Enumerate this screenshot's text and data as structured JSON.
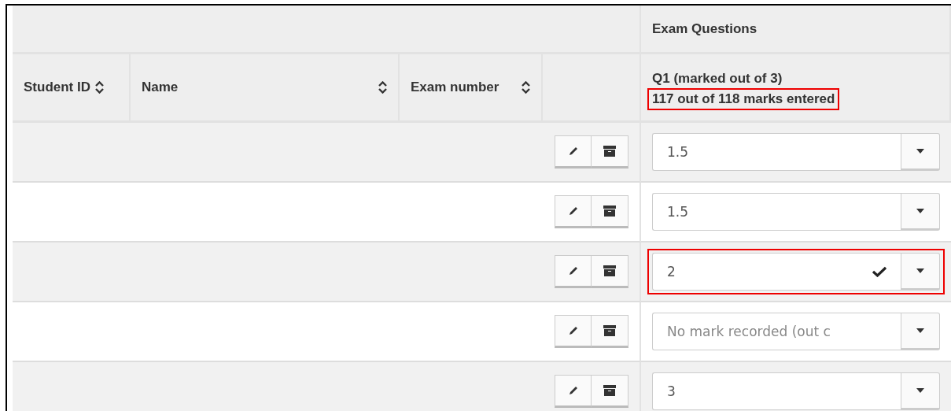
{
  "table": {
    "group_header": "Exam Questions",
    "columns": [
      {
        "label": "Student ID"
      },
      {
        "label": "Name"
      },
      {
        "label": "Exam number"
      }
    ],
    "question": {
      "title": "Q1 (marked out of 3)",
      "summary": "117 out of 118 marks entered",
      "highlighted": true
    },
    "rows": [
      {
        "mark": {
          "value": "1.5",
          "saved": false,
          "highlighted": false
        }
      },
      {
        "mark": {
          "value": "1.5",
          "saved": false,
          "highlighted": false
        }
      },
      {
        "mark": {
          "value": "2",
          "saved": true,
          "highlighted": true
        }
      },
      {
        "mark": {
          "placeholder": "No mark recorded (out c",
          "saved": false,
          "highlighted": false
        }
      },
      {
        "mark": {
          "value": "3",
          "saved": false,
          "highlighted": false
        }
      }
    ]
  }
}
